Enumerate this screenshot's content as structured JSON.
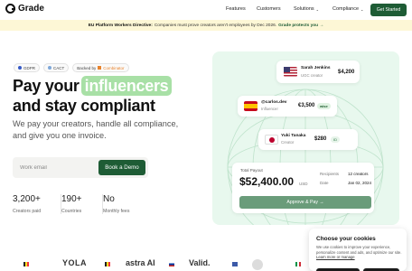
{
  "nav": {
    "logo_text": "Grade",
    "links": [
      "Features",
      "Customers",
      "Solutions",
      "Compliance"
    ],
    "cta": "Get Started"
  },
  "banner": {
    "bold": "EU Platform Workers Directive:",
    "text": "Companies must prove creators aren't employees by Dec 2026.",
    "cta": "Grade protects you →"
  },
  "hero": {
    "badges": [
      "GDPR",
      "CACT"
    ],
    "backed_label": "Backed by",
    "backed_by": "Combinator",
    "title_pre": "Pay your",
    "title_highlight": "influencers",
    "title_post": "and stay compliant",
    "subtitle": "We pay your creators, handle all compliance, and give you one invoice.",
    "email_placeholder": "Work email",
    "demo_button": "Book a Demo",
    "stats": [
      {
        "value": "3,200+",
        "label": "Creators paid"
      },
      {
        "value": "190+",
        "label": "Countries"
      },
      {
        "value": "No",
        "label": "Monthly fees"
      }
    ]
  },
  "creators": [
    {
      "name": "Sarah Jenkins",
      "role": "UGC creator",
      "amount": "$4,200"
    },
    {
      "name": "@carlos.dev",
      "role": "Influencer",
      "amount": "€3,500",
      "badge": "wise"
    },
    {
      "name": "Yuki Tanaka",
      "role": "Creator",
      "amount": "$280",
      "badge": "ID"
    }
  ],
  "payout": {
    "label": "Total Payout",
    "amount": "$52,400.00",
    "currency": "USD",
    "recipients_label": "Recipients",
    "recipients_value": "12 creators",
    "date_label": "Date",
    "date_value": "Jan 02, 2024",
    "approve_button": "Approve & Pay →"
  },
  "logos": [
    "YOLA",
    "astra AI",
    "Valid."
  ],
  "cookie": {
    "title": "Choose your cookies",
    "text_pre": "We use cookies to improve your experience, personalize content and ads, and optimize our site.",
    "link": "Learn more or manage"
  },
  "colors": {
    "brand": "#1e5c35",
    "highlight": "#a8e0a6",
    "panel": "#e8f8ee",
    "banner": "#fdf7d6"
  }
}
